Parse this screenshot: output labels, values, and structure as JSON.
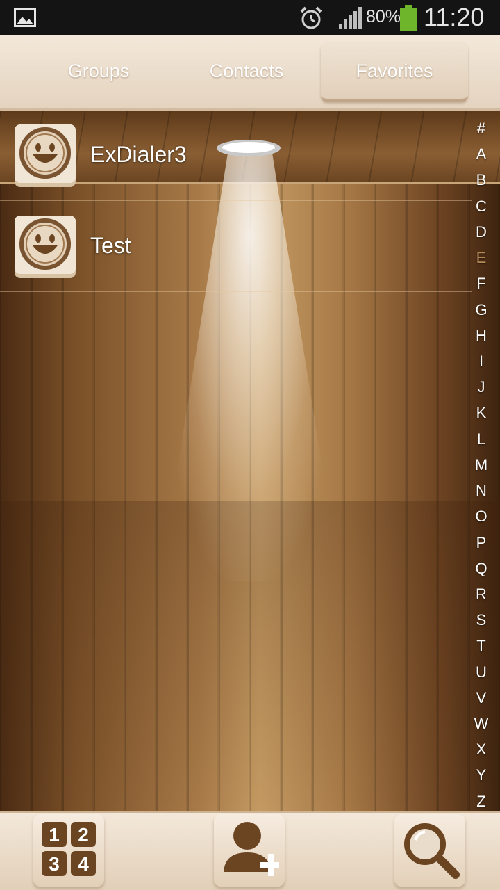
{
  "status_bar": {
    "battery_percent": "80%",
    "time": "11:20",
    "icons": [
      "gallery-icon",
      "alarm-icon",
      "signal-icon",
      "battery-icon"
    ],
    "battery_color": "#6fb52c"
  },
  "tabs": [
    {
      "label": "Groups",
      "selected": false
    },
    {
      "label": "Contacts",
      "selected": false
    },
    {
      "label": "Favorites",
      "selected": true
    }
  ],
  "favorites": [
    {
      "name": "ExDialer3",
      "icon": "smiley-avatar-icon"
    },
    {
      "name": "Test",
      "icon": "smiley-avatar-icon"
    }
  ],
  "alpha_index": {
    "letters": [
      "#",
      "A",
      "B",
      "C",
      "D",
      "E",
      "F",
      "G",
      "H",
      "I",
      "J",
      "K",
      "L",
      "M",
      "N",
      "O",
      "P",
      "Q",
      "R",
      "S",
      "T",
      "U",
      "V",
      "W",
      "X",
      "Y",
      "Z"
    ],
    "active": "E",
    "active_color": "#b58857"
  },
  "bottom_bar": {
    "dialpad_digits": [
      "1",
      "2",
      "3",
      "4"
    ],
    "buttons": [
      "dialpad-icon",
      "add-contact-icon",
      "search-icon"
    ]
  },
  "colors": {
    "accent_brown": "#6b4522",
    "tab_background": "#f3e8da"
  }
}
